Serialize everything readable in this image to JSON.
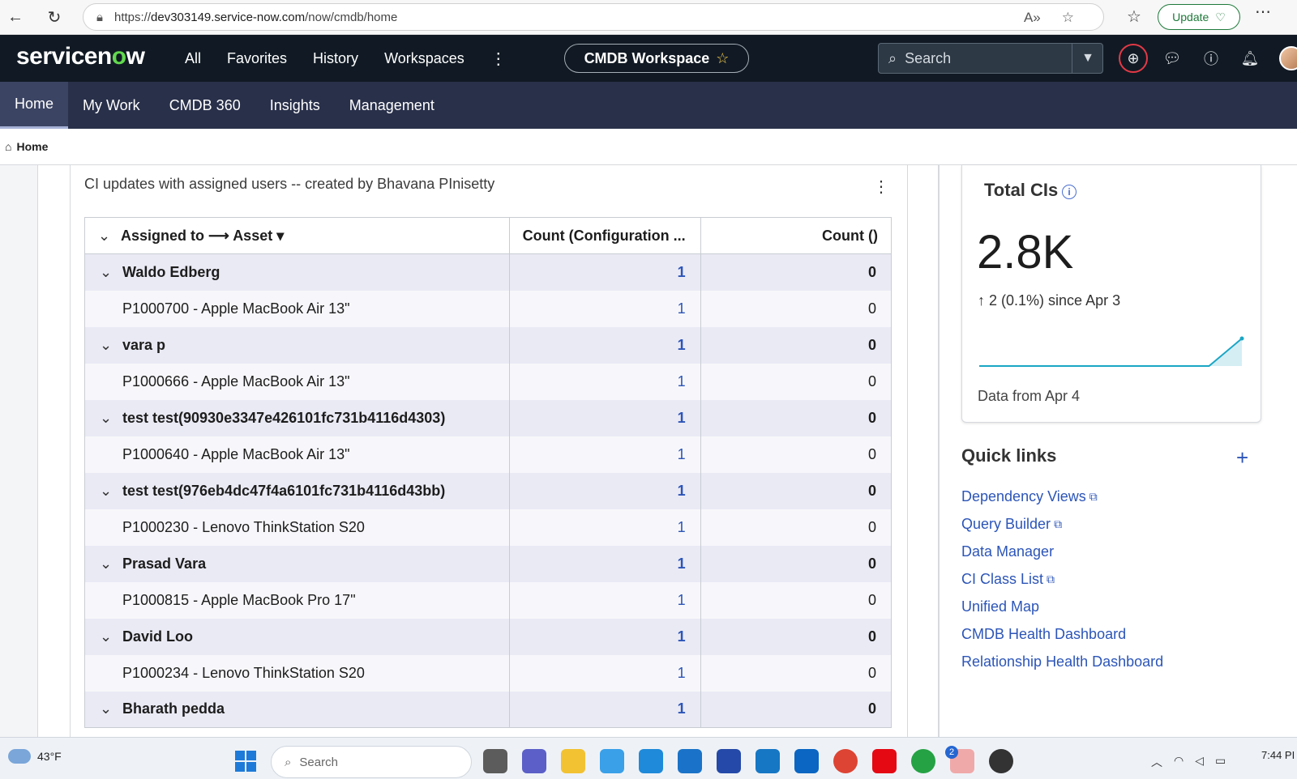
{
  "browser": {
    "url_prefix": "https://",
    "url_host": "dev303149.service-now.com",
    "url_path": "/now/cmdb/home",
    "update_label": "Update"
  },
  "header": {
    "logo": "servicenow",
    "nav": [
      "All",
      "Favorites",
      "History",
      "Workspaces"
    ],
    "workspace_pill": "CMDB Workspace",
    "search_placeholder": "Search"
  },
  "tabs": [
    {
      "label": "Home",
      "active": true
    },
    {
      "label": "My Work",
      "active": false
    },
    {
      "label": "CMDB 360",
      "active": false
    },
    {
      "label": "Insights",
      "active": false
    },
    {
      "label": "Management",
      "active": false
    }
  ],
  "breadcrumb": "Home",
  "report": {
    "title": "CI updates with assigned users -- created by Bhavana PInisetty",
    "columns": {
      "group": "Assigned to",
      "arrow": "⟶",
      "sub": "Asset",
      "count1": "Count (Configuration ...",
      "count2": "Count ()"
    },
    "rows": [
      {
        "type": "group",
        "label": "Waldo Edberg",
        "c1": "1",
        "c2": "0"
      },
      {
        "type": "child",
        "label": "P1000700 - Apple MacBook Air 13\"",
        "c1": "1",
        "c2": "0"
      },
      {
        "type": "group",
        "label": "vara p",
        "c1": "1",
        "c2": "0"
      },
      {
        "type": "child",
        "label": "P1000666 - Apple MacBook Air 13\"",
        "c1": "1",
        "c2": "0"
      },
      {
        "type": "group",
        "label": "test test(90930e3347e426101fc731b4116d4303)",
        "c1": "1",
        "c2": "0"
      },
      {
        "type": "child",
        "label": "P1000640 - Apple MacBook Air 13\"",
        "c1": "1",
        "c2": "0"
      },
      {
        "type": "group",
        "label": "test test(976eb4dc47f4a6101fc731b4116d43bb)",
        "c1": "1",
        "c2": "0"
      },
      {
        "type": "child",
        "label": "P1000230 - Lenovo ThinkStation S20",
        "c1": "1",
        "c2": "0"
      },
      {
        "type": "group",
        "label": "Prasad Vara",
        "c1": "1",
        "c2": "0"
      },
      {
        "type": "child",
        "label": "P1000815 - Apple MacBook Pro 17\"",
        "c1": "1",
        "c2": "0"
      },
      {
        "type": "group",
        "label": "David Loo",
        "c1": "1",
        "c2": "0"
      },
      {
        "type": "child",
        "label": "P1000234 - Lenovo ThinkStation S20",
        "c1": "1",
        "c2": "0"
      },
      {
        "type": "group",
        "label": "Bharath pedda",
        "c1": "1",
        "c2": "0"
      }
    ]
  },
  "kpi": {
    "title": "Total CIs",
    "value": "2.8K",
    "delta": "2 (0.1%) since Apr 3",
    "footer": "Data from Apr 4",
    "sparkline": [
      0,
      0,
      0,
      0,
      0,
      0,
      0,
      0,
      2
    ]
  },
  "quick_links": {
    "title": "Quick links",
    "items": [
      {
        "label": "Dependency Views",
        "external": true
      },
      {
        "label": "Query Builder",
        "external": true
      },
      {
        "label": "Data Manager",
        "external": false
      },
      {
        "label": "CI Class List",
        "external": true
      },
      {
        "label": "Unified Map",
        "external": false
      },
      {
        "label": "CMDB Health Dashboard",
        "external": false
      },
      {
        "label": "Relationship Health Dashboard",
        "external": false
      }
    ]
  },
  "taskbar": {
    "weather": "43°F",
    "search": "Search",
    "time": "7:44 PI",
    "badge": "2"
  },
  "colors": {
    "header_bg": "#111a24",
    "subnav_bg": "#29304a",
    "link": "#2c55b8",
    "group_row": "#eaeaf5",
    "spark": "#1aa6c4"
  }
}
